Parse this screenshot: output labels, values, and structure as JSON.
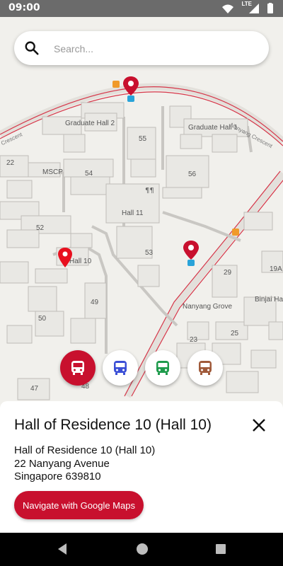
{
  "status_bar": {
    "time": "09:00",
    "network": "LTE"
  },
  "search": {
    "placeholder": "Search..."
  },
  "map": {
    "labels": {
      "graduate_hall_2": "Graduate Hall 2",
      "graduate_hall_1": "Graduate Hall 1",
      "nanyang_crescent": "Nanyang Crescent",
      "hall_11": "Hall 11",
      "hall_10": "Hall 10",
      "mscp": "MSCP",
      "nanyang_grove": "Nanyang Grove",
      "binjai_hall": "Binjai Hall",
      "crescent_left": "Crescent",
      "b22": "22",
      "b55": "55",
      "b54": "54",
      "b56": "56",
      "b52": "52",
      "b53": "53",
      "b49": "49",
      "b50": "50",
      "b47": "47",
      "b48": "48",
      "b29": "29",
      "b19a": "19A",
      "b25": "25",
      "b23": "23"
    }
  },
  "transport_buttons": [
    {
      "name": "red-bus",
      "color": "#c8102e",
      "active": true
    },
    {
      "name": "blue-bus",
      "color": "#3b4fd6",
      "active": false
    },
    {
      "name": "green-bus",
      "color": "#1f9b4c",
      "active": false
    },
    {
      "name": "brown-bus",
      "color": "#a05a3a",
      "active": false
    }
  ],
  "details": {
    "title": "Hall of Residence 10 (Hall 10)",
    "address_line1": "Hall of Residence 10 (Hall 10)",
    "address_line2": "22 Nanyang Avenue",
    "address_line3": "Singapore 639810",
    "navigate_label": "Navigate with Google Maps"
  },
  "colors": {
    "accent": "#c8102e",
    "map_bg": "#f1f0ec",
    "road": "#c8102e"
  }
}
